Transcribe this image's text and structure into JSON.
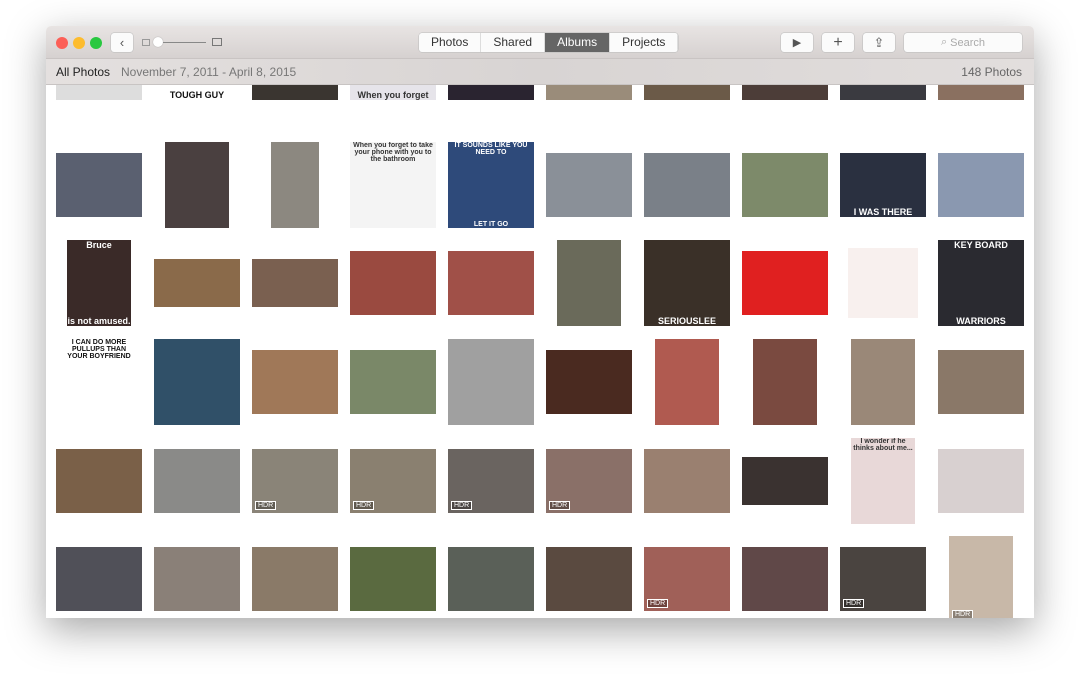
{
  "toolbar": {
    "back": "‹",
    "tabs": [
      "Photos",
      "Shared",
      "Albums",
      "Projects"
    ],
    "active_tab": "Albums",
    "search_placeholder": "Search",
    "play_icon": "▶",
    "add_icon": "+",
    "share_icon": "⇪",
    "search_icon": "⌕"
  },
  "subheader": {
    "title": "All Photos",
    "date_range": "November 7, 2011 - April 8, 2015",
    "count": "148 Photos"
  },
  "zoom_slider": {
    "value": 0.05
  },
  "rows": [
    [
      {
        "c": "#ddd",
        "t": "• • •",
        "tc": "#333"
      },
      {
        "c": "#fff",
        "b": "TOUGH GUY",
        "tc": "#111"
      },
      {
        "c": "#3a3530"
      },
      {
        "c": "#e6e4ea",
        "b": "When you forget",
        "tc": "#333"
      },
      {
        "c": "#2a2430"
      },
      {
        "c": "#9a8c7a"
      },
      {
        "c": "#6b5a48"
      },
      {
        "c": "#4c3d38"
      },
      {
        "c": "#3a3a40"
      },
      {
        "c": "#8a7060"
      }
    ],
    [
      {
        "c": "#5a6070"
      },
      {
        "c": "#4a4040"
      },
      {
        "c": "#8c8880"
      },
      {
        "c": "#f4f4f4",
        "t": "When you forget to take your phone with you to the bathroom",
        "tc": "#333"
      },
      {
        "c": "#2e4a7a",
        "t": "IT SOUNDS LIKE YOU NEED TO",
        "b": "LET IT GO"
      },
      {
        "c": "#8a9098"
      },
      {
        "c": "#7a8088"
      },
      {
        "c": "#7d8a6a"
      },
      {
        "c": "#2a3040",
        "b": "I WAS THERE"
      },
      {
        "c": "#8a98b0"
      }
    ],
    [
      {
        "c": "#3a2a28",
        "t": "Bruce",
        "b": "is not amused."
      },
      {
        "c": "#8a6a4a"
      },
      {
        "c": "#7a6050"
      },
      {
        "c": "#9a4a40"
      },
      {
        "c": "#a05048"
      },
      {
        "c": "#6a6a5a"
      },
      {
        "c": "#3a3028",
        "b": "SERIOUSLEE"
      },
      {
        "c": "#e02020"
      },
      {
        "c": "#f8f0ee"
      },
      {
        "c": "#2a2a30",
        "t": "KEY BOARD",
        "b": "WARRIORS"
      }
    ],
    [
      {
        "c": "#fff",
        "t": "I CAN DO MORE PULLUPS THAN YOUR BOYFRIEND",
        "tc": "#111"
      },
      {
        "c": "#305068"
      },
      {
        "c": "#a07858"
      },
      {
        "c": "#7a8868"
      },
      {
        "c": "#a0a0a0"
      },
      {
        "c": "#4a2a20"
      },
      {
        "c": "#b05a50"
      },
      {
        "c": "#7a4a40"
      },
      {
        "c": "#9a8878"
      },
      {
        "c": "#8a7868"
      }
    ],
    [
      {
        "c": "#7a6048"
      },
      {
        "c": "#8a8a88"
      },
      {
        "c": "#8a8478",
        "h": true
      },
      {
        "c": "#8a8070",
        "h": true
      },
      {
        "c": "#6a6460",
        "h": true
      },
      {
        "c": "#8a7068",
        "h": true
      },
      {
        "c": "#9a8070"
      },
      {
        "c": "#3a3230"
      },
      {
        "c": "#e8d8d8",
        "t": "I wonder if he thinks about me...",
        "tc": "#333"
      },
      {
        "c": "#d8d0d0"
      }
    ],
    [
      {
        "c": "#505058"
      },
      {
        "c": "#8a8078"
      },
      {
        "c": "#8a7a68"
      },
      {
        "c": "#5a6a40"
      },
      {
        "c": "#5a6058"
      },
      {
        "c": "#5a4a40"
      },
      {
        "c": "#a06058",
        "h": true
      },
      {
        "c": "#604848"
      },
      {
        "c": "#4a4440",
        "h": true
      },
      {
        "c": "#c8b8a8",
        "h": true
      }
    ],
    [
      {
        "c": "#6080a0"
      },
      {
        "c": "#fff"
      },
      {
        "c": "#fff"
      },
      {
        "c": "#444"
      },
      {
        "c": "#fff"
      },
      {
        "c": "#fff"
      },
      {
        "c": "#fff"
      },
      {
        "c": "#c8c0b8"
      },
      {
        "c": "#fff"
      },
      {
        "c": "#fff"
      }
    ]
  ]
}
